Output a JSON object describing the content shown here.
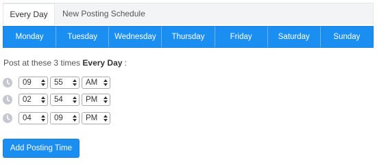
{
  "tabs": {
    "active": "Every Day",
    "other": "New Posting Schedule"
  },
  "days": [
    "Monday",
    "Tuesday",
    "Wednesday",
    "Thursday",
    "Friday",
    "Saturday",
    "Sunday"
  ],
  "caption": {
    "prefix": "Post at these 3 times",
    "emphasis": "Every Day",
    "suffix": " :"
  },
  "times": [
    {
      "hour": "09",
      "minute": "55",
      "period": "AM"
    },
    {
      "hour": "02",
      "minute": "54",
      "period": "PM"
    },
    {
      "hour": "04",
      "minute": "09",
      "period": "PM"
    }
  ],
  "icons": {
    "clock": "clock-icon"
  },
  "colors": {
    "accent": "#1b8ef2",
    "tab_bg": "#f2f4f6"
  },
  "add_button": "Add Posting Time"
}
